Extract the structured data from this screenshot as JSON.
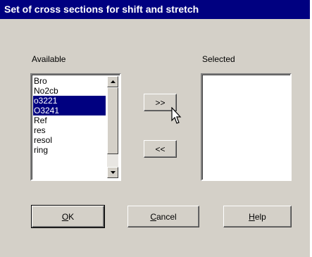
{
  "window": {
    "title": "Set of cross sections for shift and stretch"
  },
  "available": {
    "label": "Available",
    "items": [
      {
        "text": "Bro",
        "selected": false
      },
      {
        "text": "No2cb",
        "selected": false
      },
      {
        "text": "o3221",
        "selected": true
      },
      {
        "text": "O3241",
        "selected": true
      },
      {
        "text": "Ref",
        "selected": false
      },
      {
        "text": "res",
        "selected": false
      },
      {
        "text": "resol",
        "selected": false
      },
      {
        "text": "ring",
        "selected": false
      }
    ]
  },
  "selected": {
    "label": "Selected",
    "items": []
  },
  "buttons": {
    "add_label": ">>",
    "remove_label": "<<",
    "ok": {
      "mnemonic": "O",
      "rest": "K"
    },
    "cancel": {
      "mnemonic": "C",
      "rest": "ancel"
    },
    "help": {
      "mnemonic": "H",
      "rest": "elp"
    }
  }
}
